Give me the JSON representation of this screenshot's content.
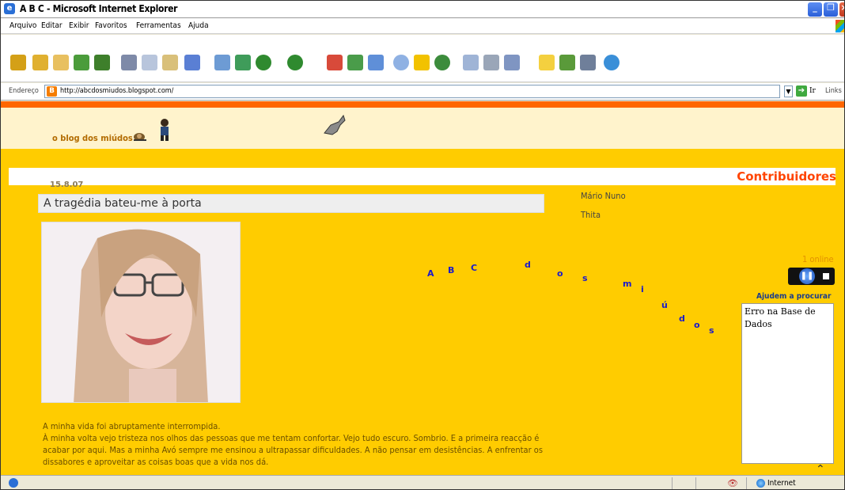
{
  "window": {
    "title": "A B C - Microsoft Internet Explorer",
    "controls": [
      "minimize",
      "maximize",
      "close"
    ]
  },
  "menu": [
    "Arquivo",
    "Editar",
    "Exibir",
    "Favoritos",
    "Ferramentas",
    "Ajuda"
  ],
  "address_bar": {
    "label": "Endereço",
    "url": "http://abcdosmiudos.blogspot.com/",
    "go_label": "Ir",
    "links_label": "Links"
  },
  "blog": {
    "title": "o blog dos miúdos",
    "post": {
      "date": "15.8.07",
      "title": "A tragédia bateu-me à porta",
      "body": [
        "A minha vida foi abruptamente interrompida.",
        "À minha volta vejo tristeza nos olhos das pessoas que me tentam confortar. Vejo tudo escuro. Sombrio. E a primeira reacção é acabar por aqui. Mas a minha Avó sempre me ensinou a ultrapassar dificuldades. A não pensar em desistências. A enfrentar os dissabores e aproveitar as coisas boas que a vida nos dá."
      ]
    },
    "sidebar": {
      "contributors_title": "Contribuidores",
      "contributors": [
        "Mário Nuno",
        "Thita"
      ],
      "online": "1 online",
      "help_title": "Ajudem a procurar",
      "db_message": "Erro na Base de Dados"
    },
    "scatter_letters": [
      "A",
      "B",
      "C",
      "d",
      "o",
      "s",
      "m",
      "i",
      "ú",
      "d",
      "o",
      "s"
    ]
  },
  "status_bar": {
    "zone": "Internet"
  },
  "colors": {
    "page_bg": "#ffcc00",
    "header_bg": "#fff3cc",
    "accent_orange": "#ff6600",
    "contributors_title": "#ff4400",
    "letters": "#1a1acc"
  }
}
